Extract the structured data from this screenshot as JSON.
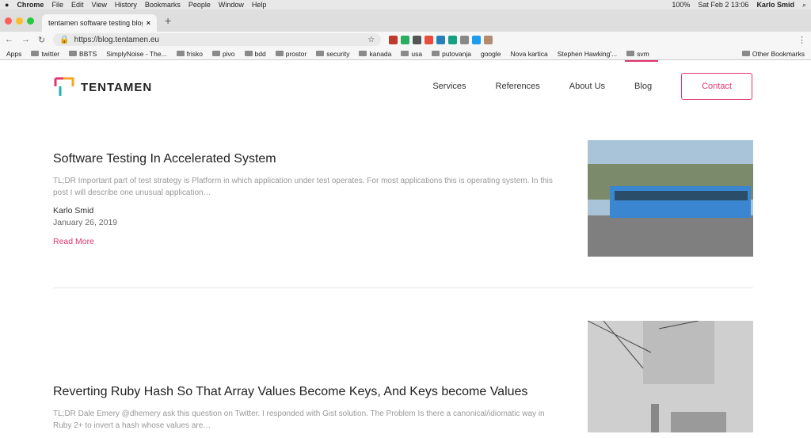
{
  "menubar": {
    "app": "Chrome",
    "items": [
      "File",
      "Edit",
      "View",
      "History",
      "Bookmarks",
      "People",
      "Window",
      "Help"
    ],
    "battery": "100%",
    "date": "Sat Feb 2  13:06",
    "user": "Karlo Smid"
  },
  "tab": {
    "title": "tentamen software testing blog"
  },
  "address": {
    "url": "https://blog.tentamen.eu"
  },
  "bookmarks": {
    "apps": "Apps",
    "items": [
      "twitter",
      "BBTS",
      "SimplyNoise - The...",
      "frisko",
      "pivo",
      "bdd",
      "prostor",
      "security",
      "kanada",
      "usa",
      "putovanja",
      "google",
      "Nova kartica",
      "Stephen Hawking'...",
      "svm"
    ],
    "other": "Other Bookmarks"
  },
  "site": {
    "logo": "TENTAMEN",
    "nav": [
      "Services",
      "References",
      "About Us",
      "Blog"
    ],
    "contact": "Contact"
  },
  "posts": [
    {
      "title": "Software Testing In Accelerated System",
      "excerpt": "TL;DR Important part of test strategy is Platform in which application under test operates. For most applications this is operating system. In this post I will describe one unusual application…",
      "author": "Karlo Smid",
      "date": "January 26, 2019",
      "more": "Read More"
    },
    {
      "title": "Reverting Ruby Hash So That Array Values Become Keys, And Keys become Values",
      "excerpt": "TL;DR Dale Emery @dhemery ask this question on Twitter. I responded with Gist solution. The Problem Is there a canonical/idiomatic way in Ruby 2+ to invert a hash whose values are…"
    }
  ]
}
